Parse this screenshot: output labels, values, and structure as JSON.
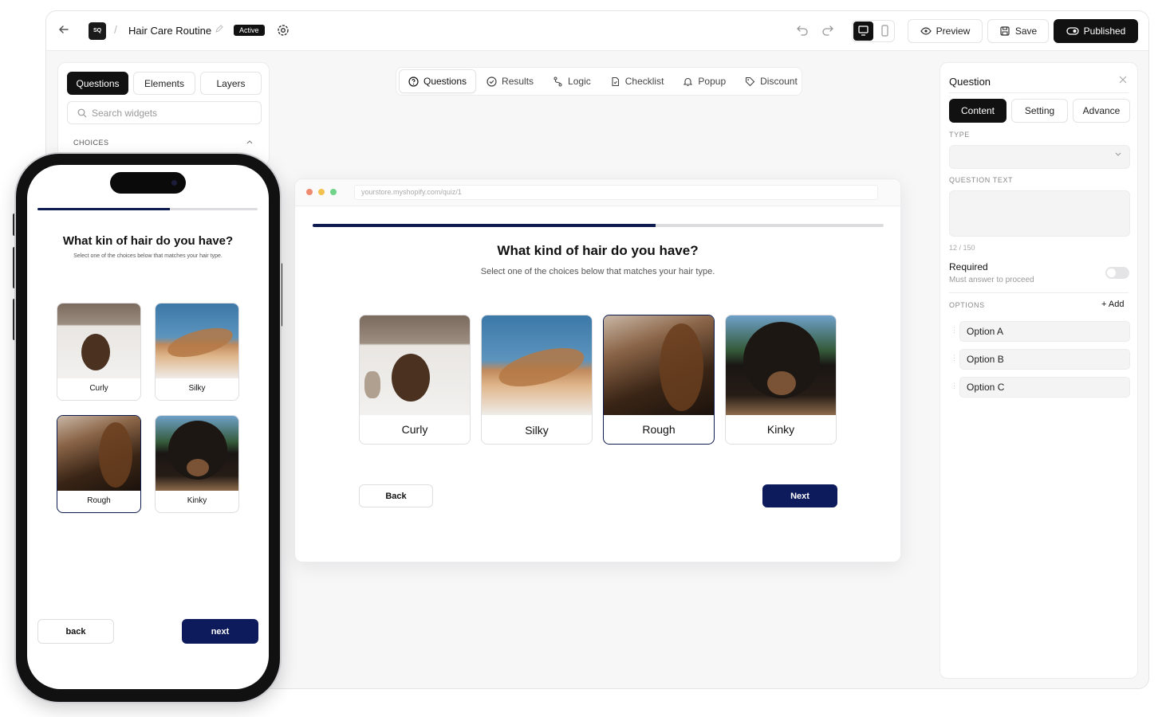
{
  "topbar": {
    "logo": "SQ",
    "title": "Hair Care Routine",
    "status_badge": "Active",
    "preview_label": "Preview",
    "save_label": "Save",
    "published_label": "Published"
  },
  "left_panel": {
    "tabs": [
      "Questions",
      "Elements",
      "Layers"
    ],
    "active_tab": "Questions",
    "search_placeholder": "Search widgets",
    "section_title": "CHOICES"
  },
  "center_tabs": [
    {
      "label": "Questions",
      "icon": "question-circle-icon",
      "active": true
    },
    {
      "label": "Results",
      "icon": "check-circle-icon",
      "active": false
    },
    {
      "label": "Logic",
      "icon": "branch-icon",
      "active": false
    },
    {
      "label": "Checklist",
      "icon": "document-check-icon",
      "active": false
    },
    {
      "label": "Popup",
      "icon": "bell-icon",
      "active": false
    },
    {
      "label": "Discount",
      "icon": "tag-icon",
      "active": false
    }
  ],
  "desktop_preview": {
    "url": "yourstore.myshopify.com/quiz/1",
    "progress": 0.6,
    "question": "What kind of hair do you have?",
    "subtitle": "Select one of the choices below that matches your hair type.",
    "choices": [
      "Curly",
      "Silky",
      "Rough",
      "Kinky"
    ],
    "selected": "Rough",
    "back_label": "Back",
    "next_label": "Next"
  },
  "mobile_preview": {
    "progress": 0.6,
    "question": "What kin of hair do you have?",
    "subtitle": "Select one of the choices below that matches your hair type.",
    "choices": [
      "Curly",
      "Silky",
      "Rough",
      "Kinky"
    ],
    "selected": "Rough",
    "back_label": "back",
    "next_label": "next"
  },
  "right_panel": {
    "title": "Question",
    "tabs": [
      "Content",
      "Setting",
      "Advance"
    ],
    "active_tab": "Content",
    "type_label": "TYPE",
    "question_text_label": "QUESTION TEXT",
    "char_count": "12 / 150",
    "required_label": "Required",
    "required_sub": "Must answer to proceed",
    "required_on": false,
    "options_label": "OPTIONS",
    "add_label": "Add",
    "options": [
      "Option A",
      "Option B",
      "Option C"
    ]
  },
  "colors": {
    "accent": "#0d1b5c",
    "progress_fill": "#0d1b4f",
    "dark": "#111111"
  }
}
